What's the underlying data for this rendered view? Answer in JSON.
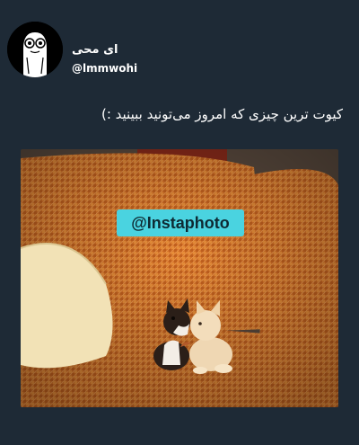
{
  "tweet": {
    "display_name": "ای محی",
    "username": "@lmmwohi",
    "text": "کیوت ترین چیزی که امروز می‌تونید ببینید :)",
    "media": {
      "watermark": "@Instaphoto",
      "description_icon": "kittens-photo"
    }
  },
  "colors": {
    "background": "#1e2a36",
    "text": "#ffffff",
    "watermark_bg": "#4ad3e0"
  }
}
